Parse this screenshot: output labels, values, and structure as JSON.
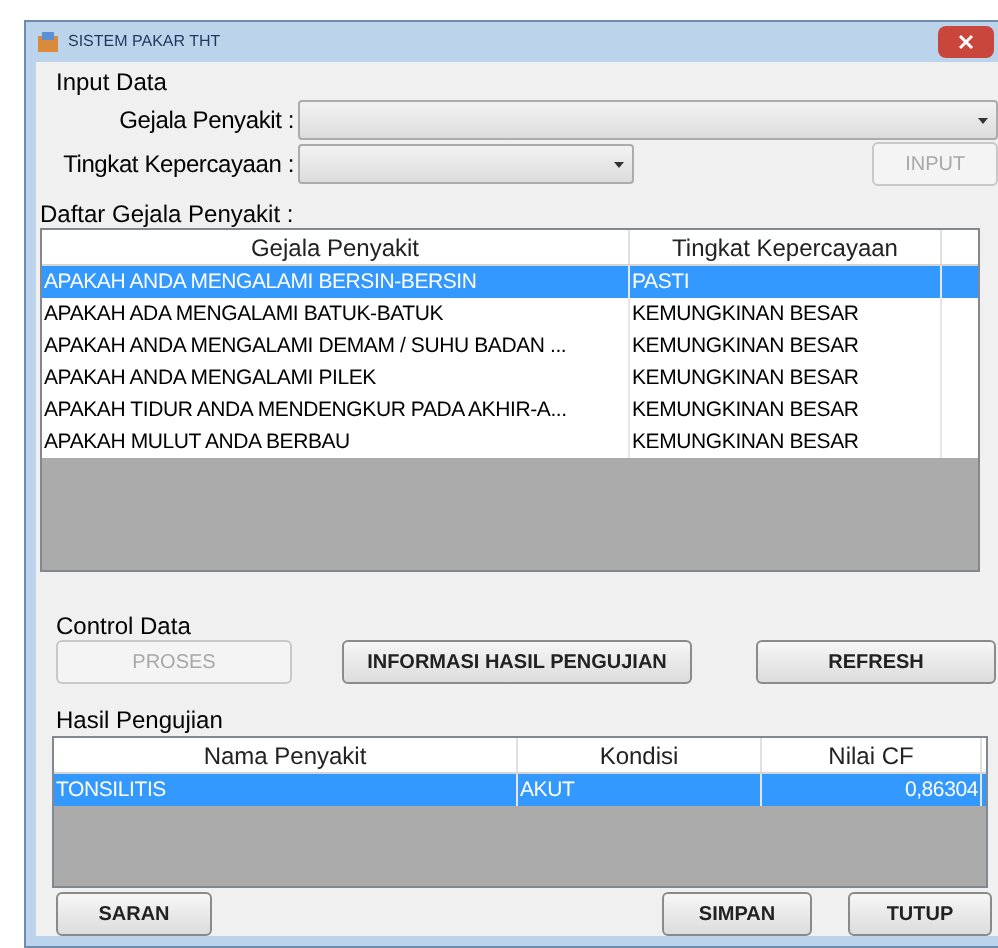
{
  "window": {
    "title": "SISTEM PAKAR THT"
  },
  "input_data": {
    "title": "Input Data",
    "fields": [
      {
        "label": "Gejala Penyakit :",
        "kind": "wide"
      },
      {
        "label": "Tingkat Kepercayaan :",
        "kind": "narrow"
      }
    ],
    "input_button": {
      "label": "INPUT",
      "disabled": true
    }
  },
  "symptoms": {
    "title": "Daftar Gejala Penyakit :",
    "columns": [
      "Gejala Penyakit",
      "Tingkat Kepercayaan"
    ],
    "rows": [
      {
        "cells": [
          "APAKAH ANDA MENGALAMI BERSIN-BERSIN",
          "PASTI"
        ],
        "selected": true
      },
      {
        "cells": [
          "APAKAH ADA MENGALAMI BATUK-BATUK",
          "KEMUNGKINAN BESAR"
        ],
        "selected": false
      },
      {
        "cells": [
          "APAKAH ANDA MENGALAMI DEMAM / SUHU BADAN ...",
          "KEMUNGKINAN BESAR"
        ],
        "selected": false
      },
      {
        "cells": [
          "APAKAH ANDA MENGALAMI PILEK",
          "KEMUNGKINAN BESAR"
        ],
        "selected": false
      },
      {
        "cells": [
          "APAKAH TIDUR ANDA MENDENGKUR PADA AKHIR-A...",
          "KEMUNGKINAN BESAR"
        ],
        "selected": false
      },
      {
        "cells": [
          "APAKAH MULUT ANDA BERBAU",
          "KEMUNGKINAN BESAR"
        ],
        "selected": false
      }
    ]
  },
  "control_data": {
    "title": "Control Data",
    "buttons": [
      {
        "label": "PROSES",
        "disabled": true
      },
      {
        "label": "INFORMASI  HASIL PENGUJIAN",
        "disabled": false
      },
      {
        "label": "REFRESH",
        "disabled": false
      }
    ]
  },
  "results": {
    "title": "Hasil Pengujian",
    "columns": [
      "Nama Penyakit",
      "Kondisi",
      "Nilai CF"
    ],
    "rows": [
      {
        "cells": [
          "TONSILITIS",
          "AKUT",
          "0,86304"
        ],
        "selected": true
      }
    ]
  },
  "bottom_buttons": [
    {
      "label": "SARAN",
      "disabled": false
    },
    {
      "label": "SIMPAN",
      "disabled": false
    },
    {
      "label": "TUTUP",
      "disabled": false
    }
  ]
}
